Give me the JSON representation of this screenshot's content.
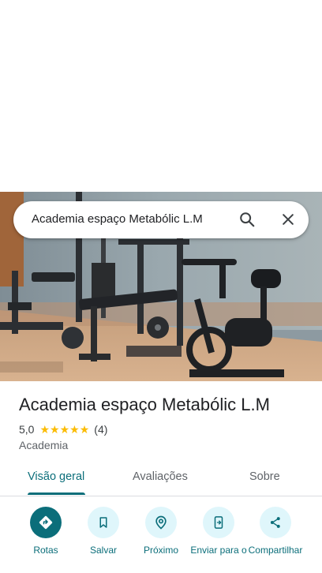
{
  "search": {
    "query": "Academia espaço Metabólic L.M"
  },
  "place": {
    "title": "Academia espaço Metabólic L.M",
    "rating": "5,0",
    "star_count": 5,
    "reviews": "(4)",
    "category": "Academia"
  },
  "tabs": [
    {
      "label": "Visão geral",
      "active": true
    },
    {
      "label": "Avaliações",
      "active": false
    },
    {
      "label": "Sobre",
      "active": false
    }
  ],
  "actions": [
    {
      "label": "Rotas",
      "icon": "directions-icon"
    },
    {
      "label": "Salvar",
      "icon": "bookmark-icon"
    },
    {
      "label": "Próximo",
      "icon": "nearby-icon"
    },
    {
      "label": "Enviar para o",
      "icon": "send-to-phone-icon"
    },
    {
      "label": "Compartilhar",
      "icon": "share-icon"
    }
  ],
  "colors": {
    "accent": "#0b6e7a",
    "action_bg": "#dff6fb",
    "star": "#fbbc04"
  }
}
